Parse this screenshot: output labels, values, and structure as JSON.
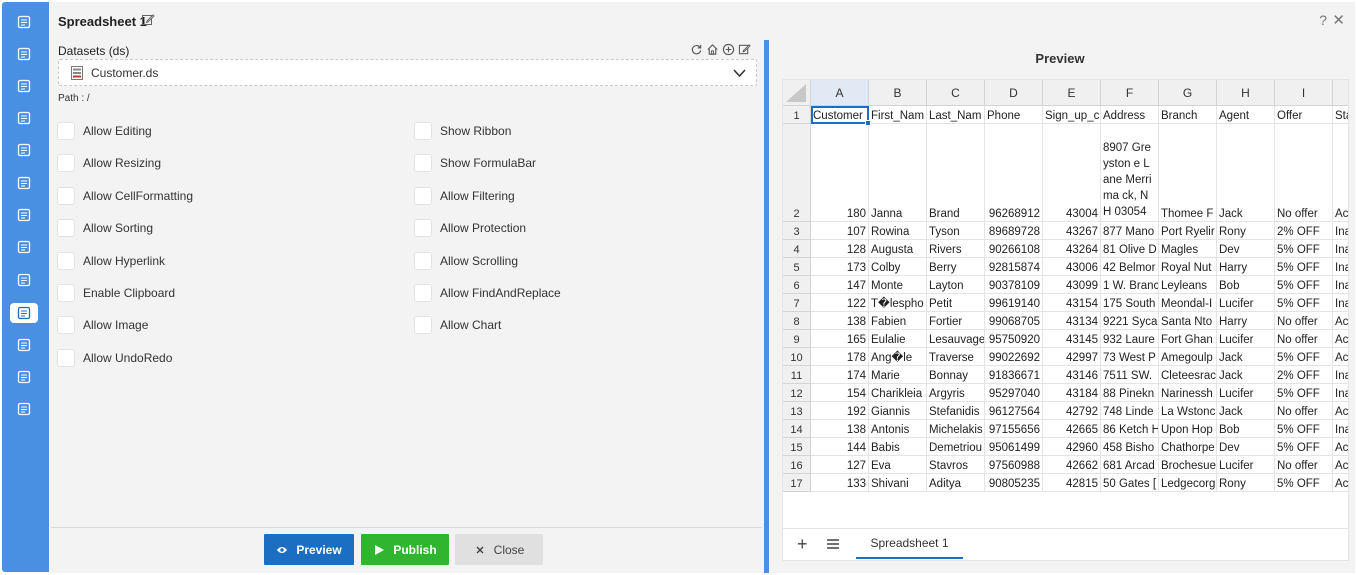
{
  "window": {
    "title": "Spreadsheet 1",
    "help": "?",
    "close": "✕"
  },
  "dataset": {
    "label": "Datasets (ds)",
    "selected": "Customer.ds",
    "path": "Path : /"
  },
  "options_left": [
    "Allow Editing",
    "Allow Resizing",
    "Allow CellFormatting",
    "Allow Sorting",
    "Allow Hyperlink",
    "Enable Clipboard",
    "Allow Image",
    "Allow UndoRedo"
  ],
  "options_right": [
    "Show Ribbon",
    "Show FormulaBar",
    "Allow Filtering",
    "Allow Protection",
    "Allow Scrolling",
    "Allow FindAndReplace",
    "Allow Chart"
  ],
  "buttons": {
    "preview": "Preview",
    "publish": "Publish",
    "close": "Close"
  },
  "preview": {
    "title": "Preview",
    "columns": [
      "A",
      "B",
      "C",
      "D",
      "E",
      "F",
      "G",
      "H",
      "I",
      ""
    ],
    "rows": [
      [
        "Customer",
        "First_Nam",
        "Last_Nam",
        "Phone",
        "Sign_up_c",
        "Address",
        "Branch",
        "Agent",
        "Offer",
        "Sta"
      ],
      [
        "180",
        "Janna",
        "Brand",
        "96268912",
        "43004",
        "8907 Greyston e Lane Merrima ck, NH 03054",
        "Thomee F",
        "Jack",
        "No offer",
        "Ac"
      ],
      [
        "107",
        "Rowina",
        "Tyson",
        "89689728",
        "43267",
        "877 Mano",
        "Port Ryelir",
        "Rony",
        "2% OFF",
        "Ina"
      ],
      [
        "128",
        "Augusta",
        "Rivers",
        "90266108",
        "43264",
        "81 Olive D",
        "Magles",
        "Dev",
        "5% OFF",
        "Ina"
      ],
      [
        "173",
        "Colby",
        "Berry",
        "92815874",
        "43006",
        "42 Belmor",
        "Royal Nut",
        "Harry",
        "5% OFF",
        "Ina"
      ],
      [
        "147",
        "Monte",
        "Layton",
        "90378109",
        "43099",
        "1 W. Branc",
        "Leyleans",
        "Bob",
        "5% OFF",
        "Ina"
      ],
      [
        "122",
        "T�lespho",
        "Petit",
        "99619140",
        "43154",
        "175 South",
        "Meondal-I",
        "Lucifer",
        "5% OFF",
        "Ina"
      ],
      [
        "138",
        "Fabien",
        "Fortier",
        "99068705",
        "43134",
        "9221 Syca",
        "Santa Nto",
        "Harry",
        "No offer",
        "Ac"
      ],
      [
        "165",
        "Eulalie",
        "Lesauvage",
        "95750920",
        "43145",
        "932 Laure",
        "Fort Ghan",
        "Lucifer",
        "No offer",
        "Ac"
      ],
      [
        "178",
        "Ang�le",
        "Traverse",
        "99022692",
        "42997",
        "73 West P",
        "Amegoulp",
        "Jack",
        "5% OFF",
        "Ac"
      ],
      [
        "174",
        "Marie",
        "Bonnay",
        "91836671",
        "43146",
        "7511 SW.",
        "Cleteesrac",
        "Jack",
        "2% OFF",
        "Ina"
      ],
      [
        "154",
        "Charikleia",
        "Argyris",
        "95297040",
        "43184",
        "88 Pinekn",
        "Narinessh",
        "Lucifer",
        "5% OFF",
        "Ina"
      ],
      [
        "192",
        "Giannis",
        "Stefanidis",
        "96127564",
        "42792",
        "748 Linde",
        "La Wstonc",
        "Jack",
        "No offer",
        "Ac"
      ],
      [
        "138",
        "Antonis",
        "Michelakis",
        "97155656",
        "42665",
        "86 Ketch H",
        "Upon Hop",
        "Bob",
        "5% OFF",
        "Ina"
      ],
      [
        "144",
        "Babis",
        "Demetriou",
        "95061499",
        "42960",
        "458 Bisho",
        "Chathorpe",
        "Dev",
        "5% OFF",
        "Ac"
      ],
      [
        "127",
        "Eva",
        "Stavros",
        "97560988",
        "42662",
        "681 Arcad",
        "Brochesue",
        "Lucifer",
        "No offer",
        "Ac"
      ],
      [
        "133",
        "Shivani",
        "Aditya",
        "90805235",
        "42815",
        "50 Gates [",
        "Ledgecorg",
        "Rony",
        "5% OFF",
        "Ac"
      ]
    ],
    "sheet_tab": "Spreadsheet 1",
    "add_sheet": "+"
  },
  "colors": {
    "accent": "#4a90e2",
    "primary": "#1b6ec2",
    "success": "#2fb52f"
  }
}
